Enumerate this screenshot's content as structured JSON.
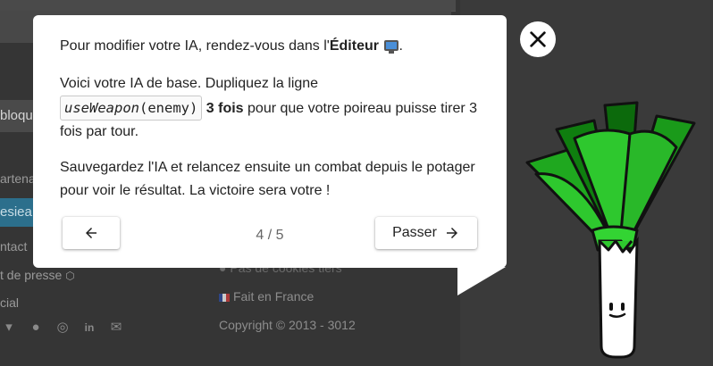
{
  "background": {
    "block_label": "bloqu",
    "menu_items": [
      "artena",
      "ntact",
      "t de presse",
      "cial"
    ],
    "highlight_label": "esiea",
    "social_icons": [
      "twitter-icon",
      "facebook-icon",
      "instagram-icon",
      "linkedin-icon",
      "mail-icon"
    ],
    "footer": {
      "cookies": "Pas de cookies tiers",
      "made_in": "Fait en France",
      "copyright": "Copyright © 2013 - 3012"
    }
  },
  "dialog": {
    "line1_prefix": "Pour modifier votre IA, rendez-vous dans l'",
    "line1_bold": "Éditeur",
    "line1_suffix": ".",
    "line2_prefix": "Voici votre IA de base. Dupliquez la ligne",
    "code_fn": "useWeapon",
    "code_args": "(enemy)",
    "line2_bold": "3 fois",
    "line2_suffix": "pour que votre poireau puisse tirer 3 fois par tour.",
    "line3": "Sauvegardez l'IA et relancez ensuite un combat depuis le potager pour voir le résultat. La victoire sera votre !",
    "counter": "4 / 5",
    "next_label": "Passer",
    "prev_icon": "arrow-left-icon",
    "next_icon": "arrow-right-icon",
    "close_icon": "close-icon"
  },
  "colors": {
    "overlay": "#3a3a3a",
    "leek_green": "#2ec82e",
    "highlight": "#2c6f8c"
  }
}
